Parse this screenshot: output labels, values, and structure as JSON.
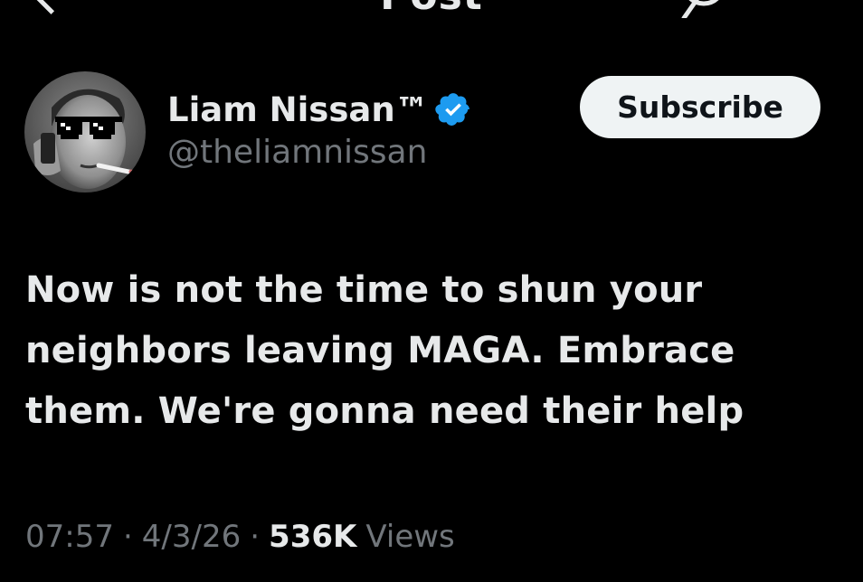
{
  "header": {
    "title": "Post",
    "back_icon": "back-arrow-icon",
    "grok_icon": "grok-icon",
    "more_icon": "more-options-icon"
  },
  "author": {
    "name": "Liam Nissan™",
    "handle": "@theliamnissan",
    "verified": true,
    "verified_color": "#1d9bf0"
  },
  "subscribe": {
    "label": "Subscribe"
  },
  "post": {
    "text": "Now is not the time to shun your neighbors leaving MAGA. Embrace them. We're gonna need their help"
  },
  "meta": {
    "time": "07:57",
    "date": "4/3/26",
    "separator": "·",
    "views_count": "536K",
    "views_label": "Views"
  },
  "colors": {
    "background": "#000000",
    "primary_text": "#e7e9ea",
    "secondary_text": "#71767b",
    "button_bg": "#eff3f4",
    "button_text": "#0f1419"
  }
}
